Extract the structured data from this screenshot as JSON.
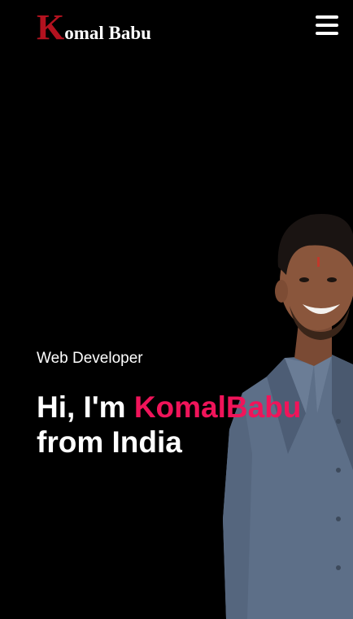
{
  "header": {
    "logo_initial": "K",
    "logo_rest": "omal Babu",
    "menu_icon": "hamburger-menu-icon"
  },
  "hero": {
    "subtitle": "Web Developer",
    "greeting": "Hi, I'm ",
    "name": "KomalBabu",
    "line2": "from India"
  },
  "colors": {
    "background": "#000000",
    "accent": "#f0145a",
    "logo_initial": "#b3121f",
    "text": "#ffffff"
  }
}
